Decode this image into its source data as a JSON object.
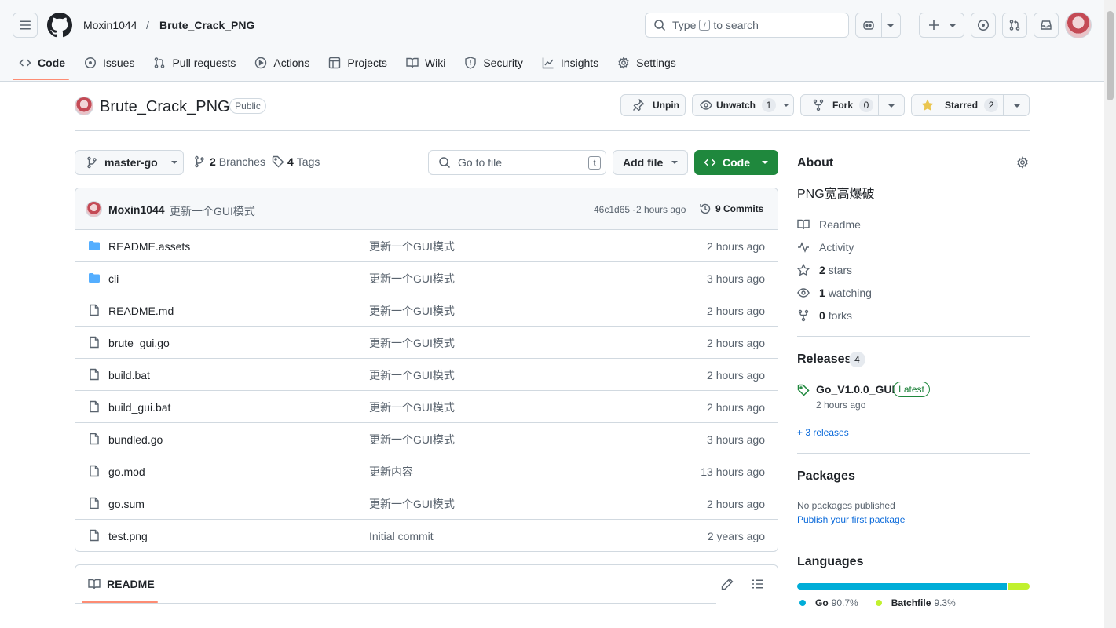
{
  "header": {
    "owner": "Moxin1044",
    "separator": "/",
    "repo": "Brute_Crack_PNG",
    "search_prefix": "Type",
    "search_key": "/",
    "search_suffix": "to search",
    "plus_label": "+"
  },
  "tabs": [
    {
      "label": "Code",
      "icon": "code-icon"
    },
    {
      "label": "Issues",
      "icon": "issue-icon"
    },
    {
      "label": "Pull requests",
      "icon": "pull-request-icon"
    },
    {
      "label": "Actions",
      "icon": "play-icon"
    },
    {
      "label": "Projects",
      "icon": "table-icon"
    },
    {
      "label": "Wiki",
      "icon": "book-icon"
    },
    {
      "label": "Security",
      "icon": "shield-icon"
    },
    {
      "label": "Insights",
      "icon": "graph-icon"
    },
    {
      "label": "Settings",
      "icon": "gear-icon"
    }
  ],
  "repo_head": {
    "title": "Brute_Crack_PNG",
    "visibility": "Public",
    "unpin": "Unpin",
    "unwatch": "Unwatch",
    "watch_count": "1",
    "fork": "Fork",
    "fork_count": "0",
    "starred": "Starred",
    "star_count": "2"
  },
  "file_nav": {
    "branch": "master-go",
    "branches_count": "2",
    "branches_label": "Branches",
    "tags_count": "4",
    "tags_label": "Tags",
    "goto_placeholder": "Go to file",
    "goto_key": "t",
    "add_file": "Add file",
    "code": "Code"
  },
  "latest_commit": {
    "author": "Moxin1044",
    "message": "更新一个GUI模式",
    "hash": "46c1d65",
    "dot": "·",
    "time": "2 hours ago",
    "commits": "9 Commits"
  },
  "files": [
    {
      "name": "README.assets",
      "type": "folder",
      "message": "更新一个GUI模式",
      "time": "2 hours ago"
    },
    {
      "name": "cli",
      "type": "folder",
      "message": "更新一个GUI模式",
      "time": "3 hours ago"
    },
    {
      "name": "README.md",
      "type": "file",
      "message": "更新一个GUI模式",
      "time": "2 hours ago"
    },
    {
      "name": "brute_gui.go",
      "type": "file",
      "message": "更新一个GUI模式",
      "time": "2 hours ago"
    },
    {
      "name": "build.bat",
      "type": "file",
      "message": "更新一个GUI模式",
      "time": "2 hours ago"
    },
    {
      "name": "build_gui.bat",
      "type": "file",
      "message": "更新一个GUI模式",
      "time": "2 hours ago"
    },
    {
      "name": "bundled.go",
      "type": "file",
      "message": "更新一个GUI模式",
      "time": "3 hours ago"
    },
    {
      "name": "go.mod",
      "type": "file",
      "message": "更新内容",
      "time": "13 hours ago"
    },
    {
      "name": "go.sum",
      "type": "file",
      "message": "更新一个GUI模式",
      "time": "2 hours ago"
    },
    {
      "name": "test.png",
      "type": "file",
      "message": "Initial commit",
      "time": "2 years ago"
    }
  ],
  "readme_tab": "README",
  "about": {
    "heading": "About",
    "description": "PNG宽高爆破",
    "readme": "Readme",
    "activity": "Activity",
    "stars_count": "2",
    "stars_label": "stars",
    "watching_count": "1",
    "watching_label": "watching",
    "forks_count": "0",
    "forks_label": "forks"
  },
  "releases": {
    "heading": "Releases",
    "count": "4",
    "tag": "Go_V1.0.0_GUI",
    "latest": "Latest",
    "time": "2 hours ago",
    "more": "+ 3 releases"
  },
  "packages": {
    "heading": "Packages",
    "none": "No packages published",
    "publish": "Publish your first package"
  },
  "languages": {
    "heading": "Languages",
    "items": [
      {
        "name": "Go",
        "percent": "90.7%",
        "value": 90.7,
        "color": "#00ADD8"
      },
      {
        "name": "Batchfile",
        "percent": "9.3%",
        "value": 9.3,
        "color": "#C1F12E"
      }
    ]
  },
  "colors": {
    "accent_green": "#1f883d",
    "link_blue": "#0969da",
    "tab_underline": "#fd8c73",
    "folder_blue": "#54aeff",
    "star_yellow": "#eac54f"
  }
}
